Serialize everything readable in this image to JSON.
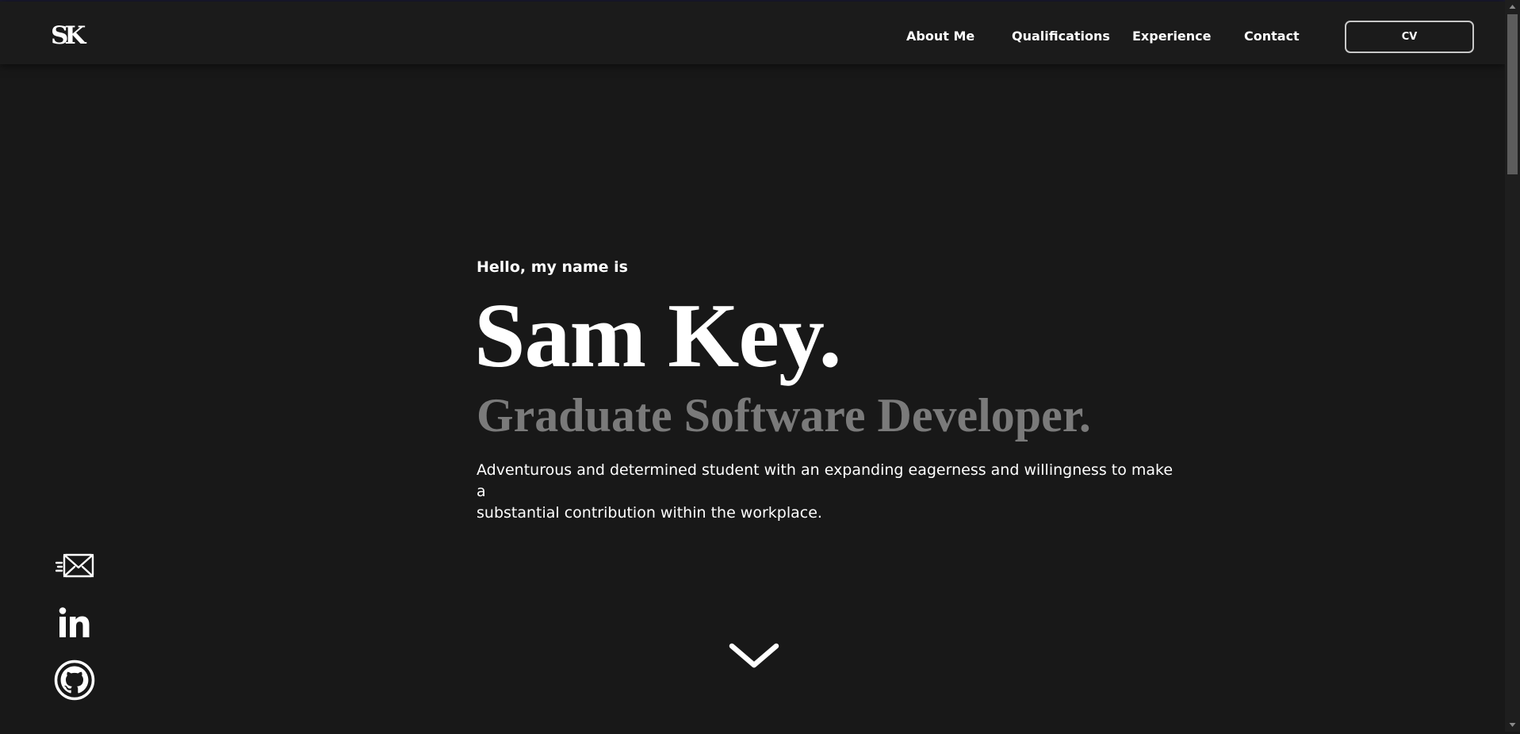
{
  "brand": {
    "logo_text": "SK"
  },
  "nav": {
    "links": [
      {
        "label": "About Me"
      },
      {
        "label": "Qualifications"
      },
      {
        "label": "Experience"
      },
      {
        "label": "Contact"
      }
    ],
    "cv_label": "CV"
  },
  "hero": {
    "greeting": "Hello, my name is",
    "name": "Sam Key.",
    "role": "Graduate Software Developer.",
    "bio_line1": "Adventurous and determined student with an expanding eagerness and willingness to make a",
    "bio_line2": "substantial contribution within the workplace."
  },
  "social": {
    "icons": [
      "email-icon",
      "linkedin-icon",
      "github-icon"
    ]
  },
  "colors": {
    "background": "#181818",
    "navbar": "#1b1b1b",
    "text": "#ffffff",
    "role_text": "#7a7a7a"
  }
}
